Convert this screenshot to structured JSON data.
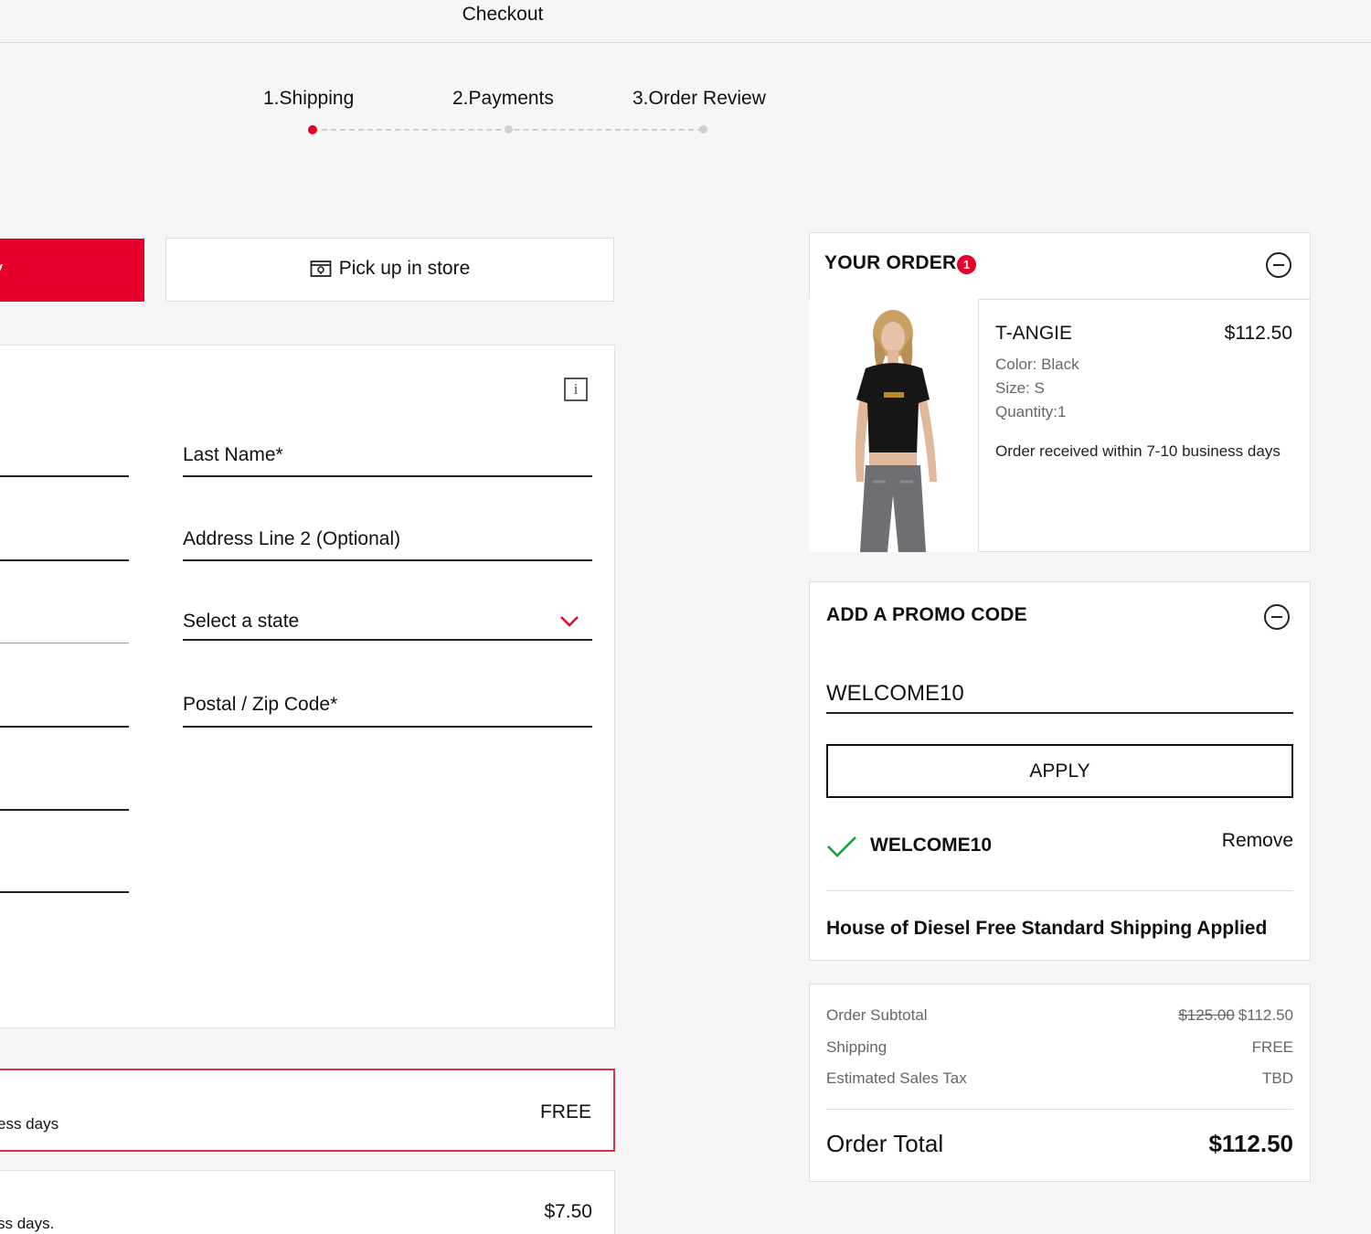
{
  "header": {
    "title": "Checkout"
  },
  "steps": [
    {
      "label": "1.Shipping"
    },
    {
      "label": "2.Payments"
    },
    {
      "label": "3.Order Review"
    }
  ],
  "delivery_tabs": {
    "delivery_label": "y",
    "pickup_label": "Pick up in store",
    "pickup_icon": "store-icon"
  },
  "form": {
    "last_name_label": "Last Name*",
    "address2_label": "Address Line 2 (Optional)",
    "state_placeholder": "Select a state",
    "postal_label": "Postal / Zip Code*",
    "info_icon": "i"
  },
  "shipping_options": [
    {
      "desc": "ess days",
      "price": "FREE",
      "selected": true
    },
    {
      "desc": "ss days.",
      "price": "$7.50",
      "selected": false
    }
  ],
  "order": {
    "title": "YOUR ORDER",
    "count": "1",
    "item": {
      "name": "T-ANGIE",
      "price": "$112.50",
      "color": "Color: Black",
      "size": "Size: S",
      "quantity": "Quantity:1",
      "delivery_note": "Order received within 7-10 business days"
    }
  },
  "promo": {
    "title": "ADD A PROMO CODE",
    "input_value": "WELCOME10",
    "apply_label": "APPLY",
    "applied_code": "WELCOME10",
    "remove_label": "Remove",
    "shipping_message": "House of Diesel Free Standard Shipping Applied"
  },
  "summary": {
    "subtotal_label": "Order Subtotal",
    "subtotal_original": "$125.00",
    "subtotal_value": "$112.50",
    "shipping_label": "Shipping",
    "shipping_value": "FREE",
    "tax_label": "Estimated Sales Tax",
    "tax_value": "TBD",
    "total_label": "Order Total",
    "total_value": "$112.50"
  },
  "colors": {
    "accent": "#e4002b",
    "success": "#1a9e3a"
  }
}
